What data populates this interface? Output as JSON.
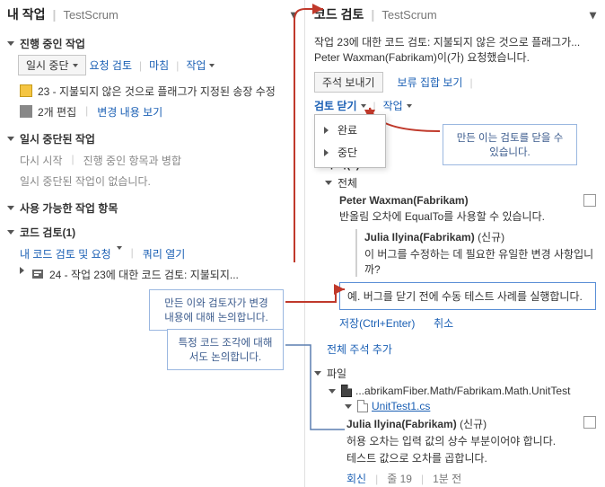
{
  "left": {
    "title": "내 작업",
    "context": "TestScrum",
    "sections": {
      "inProgress": {
        "title": "진행 중인 작업",
        "suspendBtn": "일시 중단",
        "links": {
          "requestReview": "요청 검토",
          "finish": "마침",
          "actions": "작업"
        },
        "item1": "23 - 지불되지 않은 것으로 플래그가 지정된 송장 수정",
        "item2a": "2개 편집",
        "item2b": "변경 내용 보기"
      },
      "suspended": {
        "title": "일시 중단된 작업",
        "line1a": "다시 시작",
        "line1b": "진행 중인 항목과 병합",
        "line2": "일시 중단된 작업이 없습니다."
      },
      "available": {
        "title": "사용 가능한 작업 항목"
      },
      "codeReview": {
        "title": "코드 검토(1)",
        "line1a": "내 코드 검토 및 요청",
        "line1b": "쿼리 열기",
        "item": "24 - 작업 23에 대한 코드 검토: 지불되지..."
      }
    }
  },
  "right": {
    "title": "코드 검토",
    "context": "TestScrum",
    "summary1": "작업 23에 대한 코드 검토: 지불되지 않은 것으로 플래그가...",
    "summary2": "Peter Waxman(Fabrikam)이(가) 요청했습니다.",
    "sendCommentsBtn": "주석 보내기",
    "viewShelveset": "보류 집합 보기",
    "closeReview": "검토 닫기",
    "actions": "작업",
    "ddComplete": "완료",
    "ddAbandon": "중단",
    "commentsHead": "주석(4)",
    "overall": "전체",
    "c1": {
      "author": "Peter Waxman(Fabrikam)",
      "body": "반올림 오차에 EqualTo를 사용할 수 있습니다."
    },
    "c2": {
      "author": "Julia Ilyina(Fabrikam)",
      "new": "(신규)",
      "body": "이 버그를 수정하는 데 필요한 유일한 변경 사항입니까?"
    },
    "replyText": "예. 버그를 닫기 전에 수동 테스트 사례를 실행합니다.",
    "save": "저장(Ctrl+Enter)",
    "cancel": "취소",
    "addOverall": "전체 주석 추가",
    "files": "파일",
    "filePath": "...abrikamFiber.Math/Fabrikam.Math.UnitTest",
    "fileName": "UnitTest1.cs",
    "c3": {
      "author": "Julia Ilyina(Fabrikam)",
      "new": "(신규)",
      "body1": "허용 오차는 입력 값의 상수 부분이어야 합니다.",
      "body2": "테스트 값으로 오차를 곱합니다."
    },
    "footer": {
      "reply": "회신",
      "line": "줄 19",
      "time": "1분 전"
    }
  },
  "callouts": {
    "closeTip": "만든 이는 검토를 닫을 수 있습니다.",
    "discuss": "만든 이와 검토자가 변경 내용에 대해 논의합니다.",
    "specific": "특정 코드 조각에 대해서도 논의합니다."
  }
}
